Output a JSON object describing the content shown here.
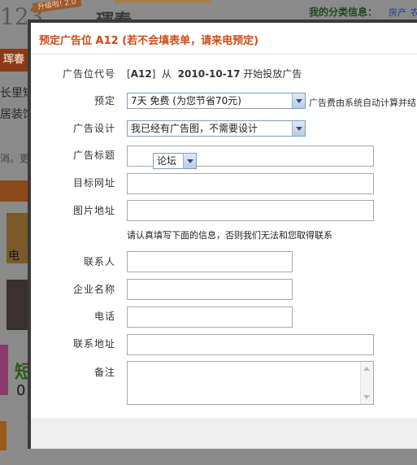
{
  "background": {
    "logo_text": "123",
    "badge_text": "升级啦! 2.0",
    "partial_title": "琿春",
    "category_label": "我的分类信息：",
    "category_link": "房产",
    "category_link2": "农",
    "tab_text": "珲春",
    "side_lines": [
      "长里短",
      "居装饰",
      "消。更"
    ],
    "tile_text": "电",
    "green_text": "短",
    "zero_text": "0"
  },
  "modal": {
    "title": "预定广告位  A12 (若不会填表单，请来电预定)",
    "fields": {
      "ad_code": {
        "label": "广告位代号",
        "code": "A12",
        "from_word": "从",
        "date": "2010-10-17",
        "suffix": "开始投放广告"
      },
      "reserve": {
        "label": "预定",
        "selected": "7天 免费 (为您节省70元)",
        "note": "广告费由系统自动计算并结"
      },
      "design": {
        "label": "广告设计",
        "selected": "我已经有广告图，不需要设计"
      },
      "ad_title": {
        "label": "广告标题",
        "overlay_select": "论坛",
        "value": ""
      },
      "target_url": {
        "label": "目标网址",
        "value": ""
      },
      "image_url": {
        "label": "图片地址",
        "value": ""
      },
      "notice": "请认真填写下面的信息，否则我们无法和您取得联系",
      "contact": {
        "label": "联系人",
        "value": ""
      },
      "company": {
        "label": "企业名称",
        "value": ""
      },
      "phone": {
        "label": "电话",
        "value": ""
      },
      "address": {
        "label": "联系地址",
        "value": ""
      },
      "remark": {
        "label": "备注",
        "value": ""
      }
    }
  }
}
